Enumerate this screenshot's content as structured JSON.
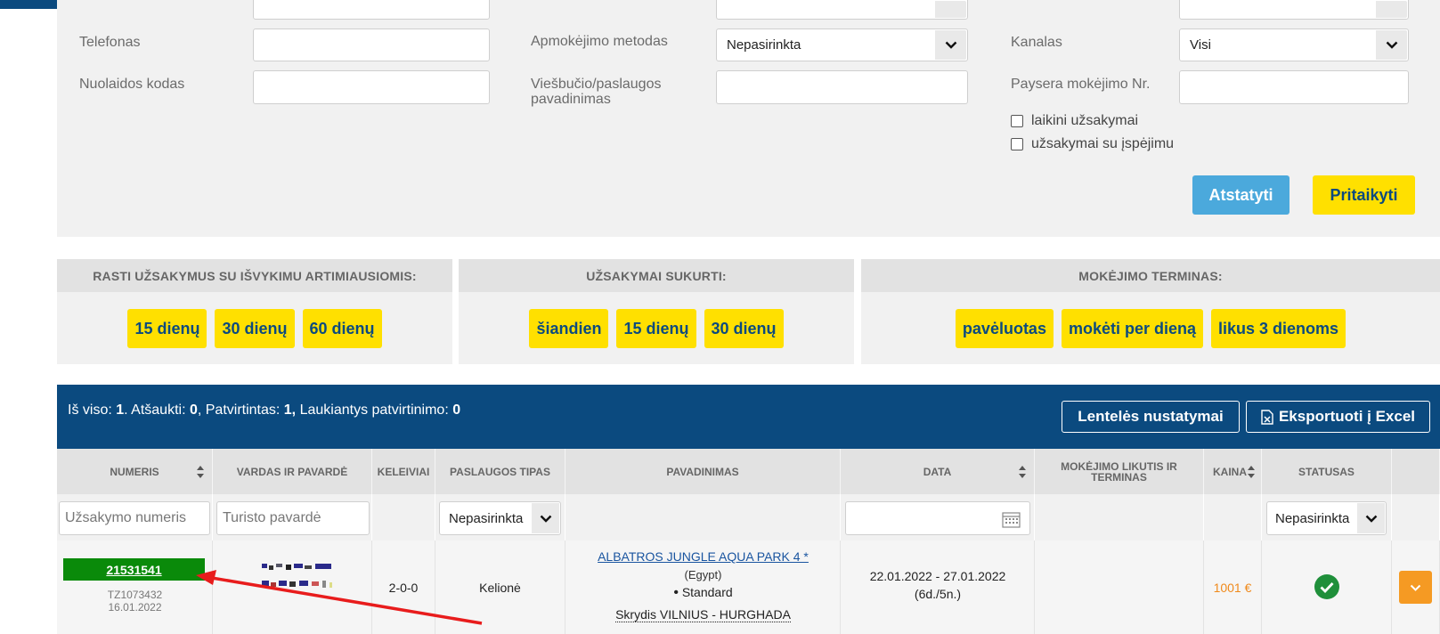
{
  "filters": {
    "phone_label": "Telefonas",
    "discount_label": "Nuolaidos kodas",
    "payment_method_label": "Apmokėjimo metodas",
    "payment_method_value": "Nepasirinkta",
    "hotel_label": "Viešbučio/paslaugos pavadinimas",
    "channel_label": "Kanalas",
    "channel_value": "Visi",
    "paysera_label": "Paysera mokėjimo Nr.",
    "temp_orders_label": "laikini užsakymai",
    "warning_orders_label": "užsakymai su įspėjimu",
    "reset_label": "Atstatyti",
    "apply_label": "Pritaikyti"
  },
  "quick": {
    "departure": {
      "title": "RASTI UŽSAKYMUS SU IŠVYKIMU ARTIMIAUSIOMIS:",
      "buttons": [
        "15 dienų",
        "30 dienų",
        "60 dienų"
      ]
    },
    "created": {
      "title": "UŽSAKYMAI SUKURTI:",
      "buttons": [
        "šiandien",
        "15 dienų",
        "30 dienų"
      ]
    },
    "payment": {
      "title": "MOKĖJIMO TERMINAS:",
      "buttons": [
        "pavėluotas",
        "mokėti per dieną",
        "likus 3 dienoms"
      ]
    }
  },
  "results": {
    "total_label": "Iš viso: ",
    "total": "1",
    "cancelled_label": ". Atšaukti: ",
    "cancelled": "0",
    "confirmed_label": ", Patvirtintas: ",
    "confirmed": "1,",
    "pending_label": " Laukiantys patvirtinimo: ",
    "pending": "0",
    "table_settings_label": "Lentelės nustatymai",
    "export_label": "Eksportuoti į Excel"
  },
  "table": {
    "headers": [
      "NUMERIS",
      "VARDAS IR PAVARDĖ",
      "KELEIVIAI",
      "PASLAUGOS TIPAS",
      "PAVADINIMAS",
      "DATA",
      "MOKĖJIMO LIKUTIS IR TERMINAS",
      "KAINA",
      "STATUSAS"
    ],
    "filters": {
      "order_number_placeholder": "Užsakymo numeris",
      "surname_placeholder": "Turisto pavardė",
      "service_type_value": "Nepasirinkta",
      "status_value": "Nepasirinkta"
    },
    "row": {
      "order_number": "21531541",
      "ref": "TZ1073432",
      "created": "16.01.2022",
      "passengers": "2-0-0",
      "service_type": "Kelionė",
      "hotel": "ALBATROS JUNGLE AQUA PARK 4 *",
      "country": "(Egypt)",
      "room": "Standard",
      "flight": "Skrydis VILNIUS - HURGHADA",
      "dates": "22.01.2022 - 27.01.2022",
      "duration": "(6d./5n.)",
      "price": "1001 €"
    }
  }
}
